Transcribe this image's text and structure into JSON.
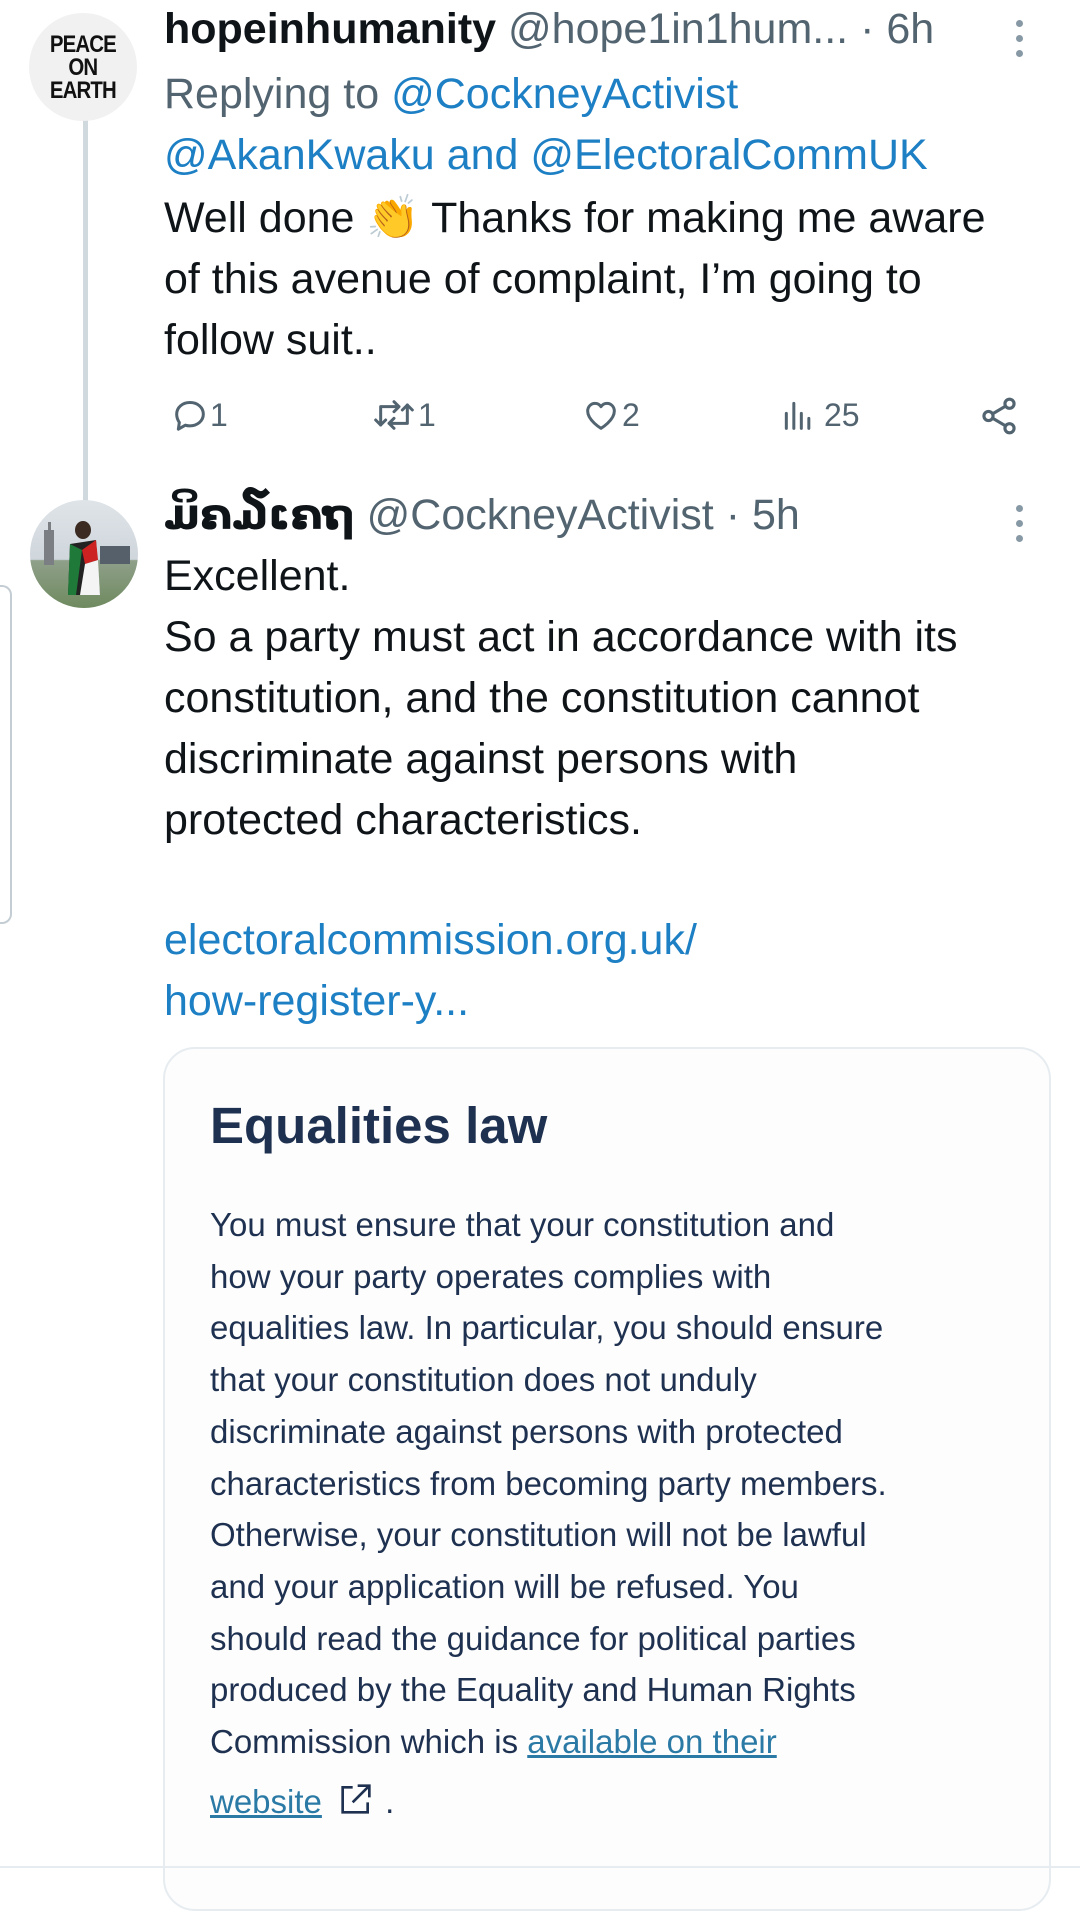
{
  "tweet1": {
    "avatar_text": [
      "PEACE",
      "ON",
      "EARTH"
    ],
    "name": "hopeinhumanity",
    "handle": "@hope1in1hum...",
    "time": "· 6h",
    "replying_prefix": "Replying to",
    "mention_1": "@CockneyActivist",
    "mention_2": "@AkanKwaku",
    "replying_and": "and",
    "mention_3": "@ElectoralCommUK",
    "text_lines": [
      "Well done 👏 Thanks for making me aware",
      "of this avenue of complaint, I’m going to",
      "follow suit.."
    ],
    "actions": {
      "replies": "1",
      "retweets": "1",
      "likes": "2",
      "views": "25"
    }
  },
  "tweet2": {
    "name": "ມິຄ໓ເຄຖ",
    "handle": "@CockneyActivist",
    "time": "· 5h",
    "text_lines": [
      "Excellent.",
      "So a party must act in accordance with its",
      "constitution, and the constitution cannot",
      "discriminate against persons with",
      "protected characteristics."
    ],
    "link_lines": [
      "electoralcommission.org.uk/",
      "how-register-y..."
    ],
    "card": {
      "title": "Equalities law",
      "body_lines": [
        "You must ensure that your constitution and",
        "how your party operates complies with",
        "equalities law. In particular, you should ensure",
        "that your constitution does not unduly",
        "discriminate against persons with protected",
        "characteristics from becoming party members.",
        "Otherwise, your constitution will not be lawful",
        "and your application will be refused. You",
        "should read the guidance for political parties",
        "produced by the Equality and Human Rights"
      ],
      "last_line_prefix": "Commission which is",
      "link_text_1": "available on their",
      "link_text_2": "website",
      "end_punct": "."
    }
  },
  "colors": {
    "link": "#1d7fc4",
    "muted": "#536471",
    "card_text": "#1f3150"
  }
}
